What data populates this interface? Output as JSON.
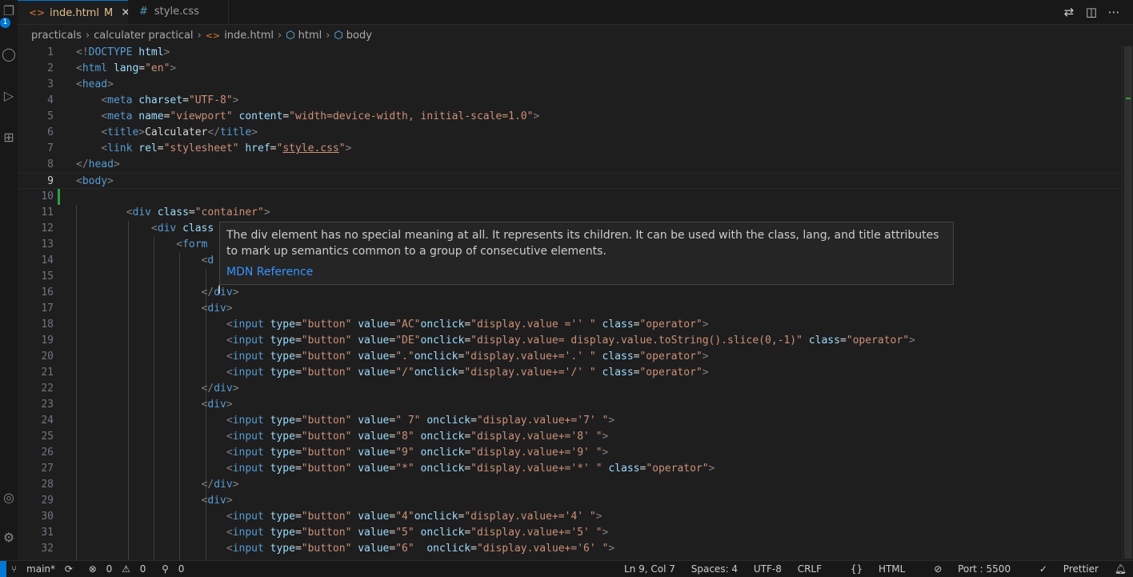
{
  "activity_badge": "1",
  "tabs": [
    {
      "label": "inde.html",
      "modified": "M",
      "active": true
    },
    {
      "label": "style.css",
      "active": false
    }
  ],
  "breadcrumb": [
    "practicals",
    "calculater practical",
    "inde.html",
    "html",
    "body"
  ],
  "editor": {
    "current_line": 9,
    "lines": [
      [
        [
          "t",
          "<!"
        ],
        [
          "n",
          "DOCTYPE"
        ],
        [
          "x",
          " "
        ],
        [
          "a",
          "html"
        ],
        [
          "t",
          ">"
        ]
      ],
      [
        [
          "t",
          "<"
        ],
        [
          "n",
          "html"
        ],
        [
          "x",
          " "
        ],
        [
          "a",
          "lang"
        ],
        [
          "x",
          "="
        ],
        [
          "v",
          "\"en\""
        ],
        [
          "t",
          ">"
        ]
      ],
      [
        [
          "t",
          "<"
        ],
        [
          "n",
          "head"
        ],
        [
          "t",
          ">"
        ]
      ],
      [
        [
          "x",
          "    "
        ],
        [
          "t",
          "<"
        ],
        [
          "n",
          "meta"
        ],
        [
          "x",
          " "
        ],
        [
          "a",
          "charset"
        ],
        [
          "x",
          "="
        ],
        [
          "v",
          "\"UTF-8\""
        ],
        [
          "t",
          ">"
        ]
      ],
      [
        [
          "x",
          "    "
        ],
        [
          "t",
          "<"
        ],
        [
          "n",
          "meta"
        ],
        [
          "x",
          " "
        ],
        [
          "a",
          "name"
        ],
        [
          "x",
          "="
        ],
        [
          "v",
          "\"viewport\""
        ],
        [
          "x",
          " "
        ],
        [
          "a",
          "content"
        ],
        [
          "x",
          "="
        ],
        [
          "v",
          "\"width=device-width, initial-scale=1.0\""
        ],
        [
          "t",
          ">"
        ]
      ],
      [
        [
          "x",
          "    "
        ],
        [
          "t",
          "<"
        ],
        [
          "n",
          "title"
        ],
        [
          "t",
          ">"
        ],
        [
          "x",
          "Calculater"
        ],
        [
          "t",
          "</"
        ],
        [
          "n",
          "title"
        ],
        [
          "t",
          ">"
        ]
      ],
      [
        [
          "x",
          "    "
        ],
        [
          "t",
          "<"
        ],
        [
          "n",
          "link"
        ],
        [
          "x",
          " "
        ],
        [
          "a",
          "rel"
        ],
        [
          "x",
          "="
        ],
        [
          "v",
          "\"stylesheet\""
        ],
        [
          "x",
          " "
        ],
        [
          "a",
          "href"
        ],
        [
          "x",
          "="
        ],
        [
          "v",
          "\""
        ],
        [
          "vu",
          "style.css"
        ],
        [
          "v",
          "\""
        ],
        [
          "t",
          ">"
        ]
      ],
      [
        [
          "t",
          "</"
        ],
        [
          "n",
          "head"
        ],
        [
          "t",
          ">"
        ]
      ],
      [
        [
          "t",
          "<"
        ],
        [
          "n",
          "body"
        ],
        [
          "t",
          ">"
        ]
      ],
      [],
      [
        [
          "x",
          "        "
        ],
        [
          "t",
          "<"
        ],
        [
          "n",
          "div"
        ],
        [
          "x",
          " "
        ],
        [
          "a",
          "class"
        ],
        [
          "x",
          "="
        ],
        [
          "v",
          "\"container\""
        ],
        [
          "t",
          ">"
        ]
      ],
      [
        [
          "x",
          "            "
        ],
        [
          "t",
          "<"
        ],
        [
          "n",
          "div"
        ],
        [
          "x",
          " "
        ],
        [
          "a",
          "class"
        ]
      ],
      [
        [
          "x",
          "                "
        ],
        [
          "t",
          "<"
        ],
        [
          "n",
          "form"
        ]
      ],
      [
        [
          "x",
          "                    "
        ],
        [
          "t",
          "<"
        ],
        [
          "n",
          "d"
        ]
      ],
      [],
      [
        [
          "x",
          "                    "
        ],
        [
          "t",
          "</"
        ],
        [
          "n",
          "div"
        ],
        [
          "t",
          ">"
        ]
      ],
      [
        [
          "x",
          "                    "
        ],
        [
          "t",
          "<"
        ],
        [
          "n",
          "div"
        ],
        [
          "t",
          ">"
        ]
      ],
      [
        [
          "x",
          "                        "
        ],
        [
          "t",
          "<"
        ],
        [
          "n",
          "input"
        ],
        [
          "x",
          " "
        ],
        [
          "a",
          "type"
        ],
        [
          "x",
          "="
        ],
        [
          "v",
          "\"button\""
        ],
        [
          "x",
          " "
        ],
        [
          "a",
          "value"
        ],
        [
          "x",
          "="
        ],
        [
          "v",
          "\"AC\""
        ],
        [
          "a",
          "onclick"
        ],
        [
          "x",
          "="
        ],
        [
          "v",
          "\"display.value ='' \""
        ],
        [
          "x",
          " "
        ],
        [
          "a",
          "class"
        ],
        [
          "x",
          "="
        ],
        [
          "v",
          "\"operator\""
        ],
        [
          "t",
          ">"
        ]
      ],
      [
        [
          "x",
          "                        "
        ],
        [
          "t",
          "<"
        ],
        [
          "n",
          "input"
        ],
        [
          "x",
          " "
        ],
        [
          "a",
          "type"
        ],
        [
          "x",
          "="
        ],
        [
          "v",
          "\"button\""
        ],
        [
          "x",
          " "
        ],
        [
          "a",
          "value"
        ],
        [
          "x",
          "="
        ],
        [
          "v",
          "\"DE\""
        ],
        [
          "a",
          "onclick"
        ],
        [
          "x",
          "="
        ],
        [
          "v",
          "\"display.value= display.value.toString().slice(0,-1)\""
        ],
        [
          "x",
          " "
        ],
        [
          "a",
          "class"
        ],
        [
          "x",
          "="
        ],
        [
          "v",
          "\"operator\""
        ],
        [
          "t",
          ">"
        ]
      ],
      [
        [
          "x",
          "                        "
        ],
        [
          "t",
          "<"
        ],
        [
          "n",
          "input"
        ],
        [
          "x",
          " "
        ],
        [
          "a",
          "type"
        ],
        [
          "x",
          "="
        ],
        [
          "v",
          "\"button\""
        ],
        [
          "x",
          " "
        ],
        [
          "a",
          "value"
        ],
        [
          "x",
          "="
        ],
        [
          "v",
          "\".\""
        ],
        [
          "a",
          "onclick"
        ],
        [
          "x",
          "="
        ],
        [
          "v",
          "\"display.value+='.' \""
        ],
        [
          "x",
          " "
        ],
        [
          "a",
          "class"
        ],
        [
          "x",
          "="
        ],
        [
          "v",
          "\"operator\""
        ],
        [
          "t",
          ">"
        ]
      ],
      [
        [
          "x",
          "                        "
        ],
        [
          "t",
          "<"
        ],
        [
          "n",
          "input"
        ],
        [
          "x",
          " "
        ],
        [
          "a",
          "type"
        ],
        [
          "x",
          "="
        ],
        [
          "v",
          "\"button\""
        ],
        [
          "x",
          " "
        ],
        [
          "a",
          "value"
        ],
        [
          "x",
          "="
        ],
        [
          "v",
          "\"/\""
        ],
        [
          "a",
          "onclick"
        ],
        [
          "x",
          "="
        ],
        [
          "v",
          "\"display.value+='/' \""
        ],
        [
          "x",
          " "
        ],
        [
          "a",
          "class"
        ],
        [
          "x",
          "="
        ],
        [
          "v",
          "\"operator\""
        ],
        [
          "t",
          ">"
        ]
      ],
      [
        [
          "x",
          "                    "
        ],
        [
          "t",
          "</"
        ],
        [
          "n",
          "div"
        ],
        [
          "t",
          ">"
        ]
      ],
      [
        [
          "x",
          "                    "
        ],
        [
          "t",
          "<"
        ],
        [
          "n",
          "div"
        ],
        [
          "t",
          ">"
        ]
      ],
      [
        [
          "x",
          "                        "
        ],
        [
          "t",
          "<"
        ],
        [
          "n",
          "input"
        ],
        [
          "x",
          " "
        ],
        [
          "a",
          "type"
        ],
        [
          "x",
          "="
        ],
        [
          "v",
          "\"button\""
        ],
        [
          "x",
          " "
        ],
        [
          "a",
          "value"
        ],
        [
          "x",
          "="
        ],
        [
          "v",
          "\" 7\""
        ],
        [
          "x",
          " "
        ],
        [
          "a",
          "onclick"
        ],
        [
          "x",
          "="
        ],
        [
          "v",
          "\"display.value+='7' \""
        ],
        [
          "t",
          ">"
        ]
      ],
      [
        [
          "x",
          "                        "
        ],
        [
          "t",
          "<"
        ],
        [
          "n",
          "input"
        ],
        [
          "x",
          " "
        ],
        [
          "a",
          "type"
        ],
        [
          "x",
          "="
        ],
        [
          "v",
          "\"button\""
        ],
        [
          "x",
          " "
        ],
        [
          "a",
          "value"
        ],
        [
          "x",
          "="
        ],
        [
          "v",
          "\"8\""
        ],
        [
          "x",
          " "
        ],
        [
          "a",
          "onclick"
        ],
        [
          "x",
          "="
        ],
        [
          "v",
          "\"display.value+='8' \""
        ],
        [
          "t",
          ">"
        ]
      ],
      [
        [
          "x",
          "                        "
        ],
        [
          "t",
          "<"
        ],
        [
          "n",
          "input"
        ],
        [
          "x",
          " "
        ],
        [
          "a",
          "type"
        ],
        [
          "x",
          "="
        ],
        [
          "v",
          "\"button\""
        ],
        [
          "x",
          " "
        ],
        [
          "a",
          "value"
        ],
        [
          "x",
          "="
        ],
        [
          "v",
          "\"9\""
        ],
        [
          "x",
          " "
        ],
        [
          "a",
          "onclick"
        ],
        [
          "x",
          "="
        ],
        [
          "v",
          "\"display.value+='9' \""
        ],
        [
          "t",
          ">"
        ]
      ],
      [
        [
          "x",
          "                        "
        ],
        [
          "t",
          "<"
        ],
        [
          "n",
          "input"
        ],
        [
          "x",
          " "
        ],
        [
          "a",
          "type"
        ],
        [
          "x",
          "="
        ],
        [
          "v",
          "\"button\""
        ],
        [
          "x",
          " "
        ],
        [
          "a",
          "value"
        ],
        [
          "x",
          "="
        ],
        [
          "v",
          "\"*\""
        ],
        [
          "x",
          " "
        ],
        [
          "a",
          "onclick"
        ],
        [
          "x",
          "="
        ],
        [
          "v",
          "\"display.value+='*' \""
        ],
        [
          "x",
          " "
        ],
        [
          "a",
          "class"
        ],
        [
          "x",
          "="
        ],
        [
          "v",
          "\"operator\""
        ],
        [
          "t",
          ">"
        ]
      ],
      [
        [
          "x",
          "                    "
        ],
        [
          "t",
          "</"
        ],
        [
          "n",
          "div"
        ],
        [
          "t",
          ">"
        ]
      ],
      [
        [
          "x",
          "                    "
        ],
        [
          "t",
          "<"
        ],
        [
          "n",
          "div"
        ],
        [
          "t",
          ">"
        ]
      ],
      [
        [
          "x",
          "                        "
        ],
        [
          "t",
          "<"
        ],
        [
          "n",
          "input"
        ],
        [
          "x",
          " "
        ],
        [
          "a",
          "type"
        ],
        [
          "x",
          "="
        ],
        [
          "v",
          "\"button\""
        ],
        [
          "x",
          " "
        ],
        [
          "a",
          "value"
        ],
        [
          "x",
          "="
        ],
        [
          "v",
          "\"4\""
        ],
        [
          "a",
          "onclick"
        ],
        [
          "x",
          "="
        ],
        [
          "v",
          "\"display.value+='4' \""
        ],
        [
          "t",
          ">"
        ]
      ],
      [
        [
          "x",
          "                        "
        ],
        [
          "t",
          "<"
        ],
        [
          "n",
          "input"
        ],
        [
          "x",
          " "
        ],
        [
          "a",
          "type"
        ],
        [
          "x",
          "="
        ],
        [
          "v",
          "\"button\""
        ],
        [
          "x",
          " "
        ],
        [
          "a",
          "value"
        ],
        [
          "x",
          "="
        ],
        [
          "v",
          "\"5\""
        ],
        [
          "x",
          " "
        ],
        [
          "a",
          "onclick"
        ],
        [
          "x",
          "="
        ],
        [
          "v",
          "\"display.value+='5' \""
        ],
        [
          "t",
          ">"
        ]
      ],
      [
        [
          "x",
          "                        "
        ],
        [
          "t",
          "<"
        ],
        [
          "n",
          "input"
        ],
        [
          "x",
          " "
        ],
        [
          "a",
          "type"
        ],
        [
          "x",
          "="
        ],
        [
          "v",
          "\"button\""
        ],
        [
          "x",
          " "
        ],
        [
          "a",
          "value"
        ],
        [
          "x",
          "="
        ],
        [
          "v",
          "\"6\""
        ],
        [
          "x",
          "  "
        ],
        [
          "a",
          "onclick"
        ],
        [
          "x",
          "="
        ],
        [
          "v",
          "\"display.value+='6' \""
        ],
        [
          "t",
          ">"
        ]
      ]
    ]
  },
  "hover": {
    "description": "The div element has no special meaning at all. It represents its children. It can be used with the class, lang, and title attributes to mark up semantics common to a group of consecutive elements.",
    "link": "MDN Reference"
  },
  "status": {
    "branch": "main*",
    "errors": "0",
    "warnings": "0",
    "ports": "0",
    "position": "Ln 9, Col 7",
    "spaces": "Spaces: 4",
    "encoding": "UTF-8",
    "eol": "CRLF",
    "language": "HTML",
    "port": "Port : 5500",
    "formatter": "Prettier"
  }
}
